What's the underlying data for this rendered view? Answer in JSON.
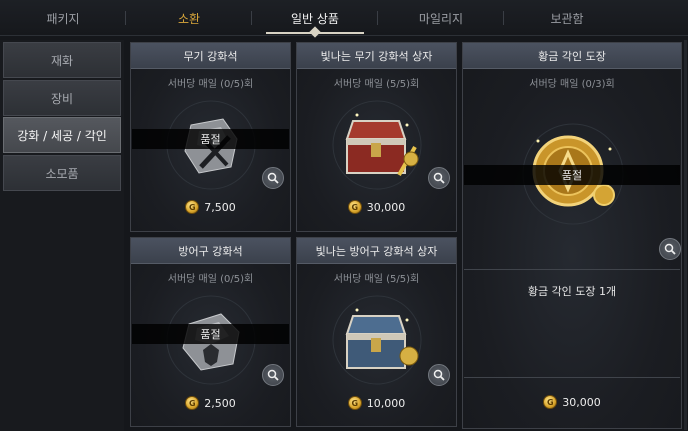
{
  "tabs": [
    {
      "label": "패키지"
    },
    {
      "label": "소환"
    },
    {
      "label": "일반 상품"
    },
    {
      "label": "마일리지"
    },
    {
      "label": "보관함"
    }
  ],
  "sidebar": {
    "items": [
      {
        "label": "재화"
      },
      {
        "label": "장비"
      },
      {
        "label": "강화 / 세공 / 각인"
      },
      {
        "label": "소모품"
      }
    ],
    "active_index": 2
  },
  "products": [
    {
      "name": "무기 강화석",
      "limit": "서버당 매일 (0/5)회",
      "price": "7,500",
      "sold_out": "품절",
      "icon": "weapon-enhance-stone-icon"
    },
    {
      "name": "빛나는 무기 강화석 상자",
      "limit": "서버당 매일 (5/5)회",
      "price": "30,000",
      "icon": "shining-weapon-stone-box-icon"
    },
    {
      "name": "황금 각인 도장",
      "limit": "서버당 매일 (0/3)회",
      "price": "30,000",
      "sold_out": "품절",
      "detail_title": "황금 각인 도장 1개",
      "icon": "golden-engraving-seal-icon"
    },
    {
      "name": "방어구 강화석",
      "limit": "서버당 매일 (0/5)회",
      "price": "2,500",
      "sold_out": "품절",
      "icon": "armor-enhance-stone-icon"
    },
    {
      "name": "빛나는 방어구 강화석 상자",
      "limit": "서버당 매일 (5/5)회",
      "price": "10,000",
      "icon": "shining-armor-stone-box-icon"
    }
  ],
  "currency": {
    "symbol": "G",
    "icon": "gold-coin-icon"
  },
  "colors": {
    "accent_gold": "#d8a63a",
    "tab_active": "#f2f2f2",
    "card_header": "#4b5260"
  }
}
